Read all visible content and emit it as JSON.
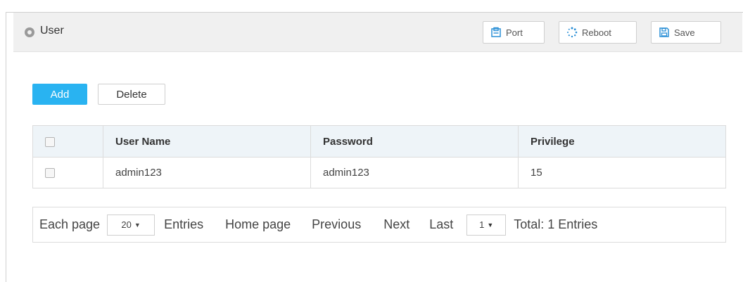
{
  "header": {
    "title": "User",
    "buttons": {
      "port": "Port",
      "reboot": "Reboot",
      "save": "Save"
    }
  },
  "actions": {
    "add": "Add",
    "delete": "Delete"
  },
  "table": {
    "columns": [
      "User Name",
      "Password",
      "Privilege"
    ],
    "rows": [
      {
        "user_name": "admin123",
        "password": "admin123",
        "privilege": "15"
      }
    ]
  },
  "pager": {
    "each_page_label": "Each page",
    "page_size": "20",
    "entries_label": "Entries",
    "home": "Home page",
    "previous": "Previous",
    "next": "Next",
    "last": "Last",
    "current_page": "1",
    "total": "Total: 1 Entries"
  },
  "colors": {
    "accent": "#29b3f1",
    "header_bg": "#f0f0f0",
    "table_header_bg": "#eef4f8"
  }
}
